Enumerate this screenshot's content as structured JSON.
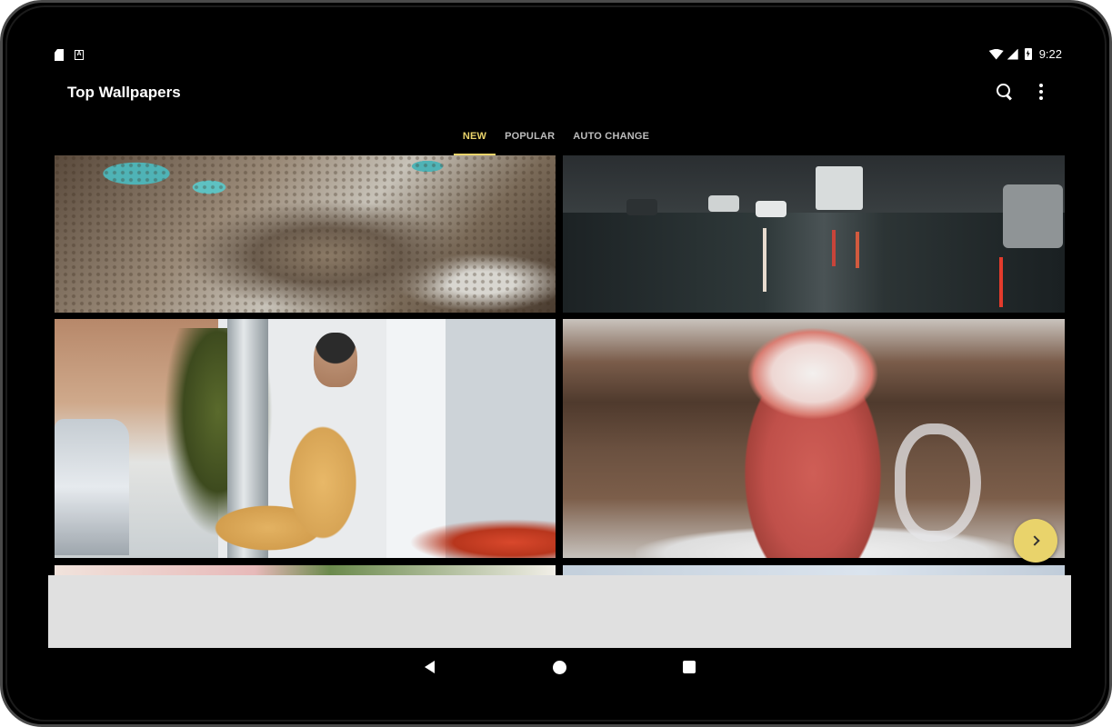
{
  "status_bar": {
    "left_icons": [
      "sd-card-icon",
      "a-notification-icon"
    ],
    "right_icons": [
      "wifi-icon",
      "signal-icon",
      "battery-charging-icon"
    ],
    "time": "9:22"
  },
  "app_bar": {
    "title": "Top Wallpapers",
    "actions": [
      "search-icon",
      "more-vert-icon"
    ]
  },
  "tabs": [
    {
      "label": "NEW",
      "active": true
    },
    {
      "label": "POPULAR",
      "active": false
    },
    {
      "label": "AUTO CHANGE",
      "active": false
    }
  ],
  "wallpapers": [
    {
      "subject": "aerial-rocky-coast"
    },
    {
      "subject": "rainy-city-street"
    },
    {
      "subject": "man-smoking-reading-phone"
    },
    {
      "subject": "strawberry-milkshake-glass"
    },
    {
      "subject": "flowers-partial"
    },
    {
      "subject": "sky-partial"
    }
  ],
  "fab": {
    "icon": "chevron-right-icon"
  },
  "nav_bar": {
    "icons": [
      "back-icon",
      "home-icon",
      "recents-icon"
    ]
  },
  "colors": {
    "accent": "#e9d36b",
    "background": "#000000",
    "tab_inactive": "#bdbdbd",
    "ad_banner": "#e0e0e0"
  }
}
